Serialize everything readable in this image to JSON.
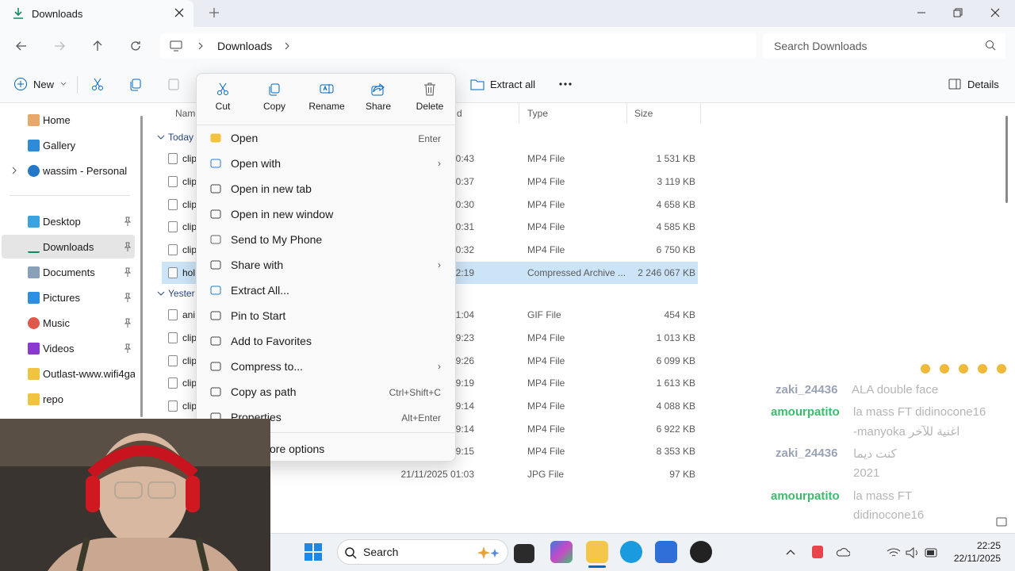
{
  "window": {
    "tab_title": "Downloads"
  },
  "address": {
    "crumb": "Downloads",
    "search_placeholder": "Search Downloads"
  },
  "commands": {
    "new_label": "New",
    "extract_all_label": "Extract all",
    "details_label": "Details"
  },
  "sidebar": {
    "items": [
      {
        "label": "Home"
      },
      {
        "label": "Gallery"
      },
      {
        "label": "wassim - Personal"
      },
      {
        "label": "Desktop"
      },
      {
        "label": "Downloads"
      },
      {
        "label": "Documents"
      },
      {
        "label": "Pictures"
      },
      {
        "label": "Music"
      },
      {
        "label": "Videos"
      },
      {
        "label": "Outlast-www.wifi4gam"
      },
      {
        "label": "repo"
      }
    ]
  },
  "columns": {
    "name": "Nam",
    "date": "d",
    "type": "Type",
    "size": "Size"
  },
  "groups": {
    "today": "Today",
    "yesterday": "Yester"
  },
  "rows": [
    {
      "name": "clip",
      "date": "0:43",
      "type": "MP4 File",
      "size": "1 531 KB"
    },
    {
      "name": "clip",
      "date": "0:37",
      "type": "MP4 File",
      "size": "3 119 KB"
    },
    {
      "name": "clip",
      "date": "0:30",
      "type": "MP4 File",
      "size": "4 658 KB"
    },
    {
      "name": "clip",
      "date": "0:31",
      "type": "MP4 File",
      "size": "4 585 KB"
    },
    {
      "name": "clip",
      "date": "0:32",
      "type": "MP4 File",
      "size": "6 750 KB"
    },
    {
      "name": "hol",
      "date": "2:19",
      "type": "Compressed Archive ...",
      "size": "2 246 067 KB"
    },
    {
      "name": "ani",
      "date": "1:04",
      "type": "GIF File",
      "size": "454 KB"
    },
    {
      "name": "clip",
      "date": "9:23",
      "type": "MP4 File",
      "size": "1 013 KB"
    },
    {
      "name": "clip",
      "date": "9:26",
      "type": "MP4 File",
      "size": "6 099 KB"
    },
    {
      "name": "clip",
      "date": "9:19",
      "type": "MP4 File",
      "size": "1 613 KB"
    },
    {
      "name": "clip",
      "date": "9:14",
      "type": "MP4 File",
      "size": "4 088 KB"
    },
    {
      "name": "",
      "date": "9:14",
      "type": "MP4 File",
      "size": "6 922 KB"
    },
    {
      "name": "",
      "date": "9:15",
      "type": "MP4 File",
      "size": "8 353 KB"
    },
    {
      "name": "",
      "date": "21/11/2025 01:03",
      "type": "JPG File",
      "size": "97 KB"
    }
  ],
  "context_menu": {
    "quick_actions": [
      {
        "label": "Cut",
        "icon": "scissors-icon"
      },
      {
        "label": "Copy",
        "icon": "copy-icon"
      },
      {
        "label": "Rename",
        "icon": "rename-icon"
      },
      {
        "label": "Share",
        "icon": "share-icon"
      },
      {
        "label": "Delete",
        "icon": "trash-icon"
      }
    ],
    "items": [
      {
        "label": "Open",
        "shortcut": "Enter"
      },
      {
        "label": "Open with",
        "shortcut": ""
      },
      {
        "label": "Open in new tab",
        "shortcut": ""
      },
      {
        "label": "Open in new window",
        "shortcut": ""
      },
      {
        "label": "Send to My Phone",
        "shortcut": ""
      },
      {
        "label": "Share with",
        "shortcut": ""
      },
      {
        "label": "Extract All...",
        "shortcut": ""
      },
      {
        "label": "Pin to Start",
        "shortcut": ""
      },
      {
        "label": "Add to Favorites",
        "shortcut": ""
      },
      {
        "label": "Compress to...",
        "shortcut": ""
      },
      {
        "label": "Copy as path",
        "shortcut": "Ctrl+Shift+C"
      },
      {
        "label": "Properties",
        "shortcut": "Alt+Enter"
      }
    ],
    "more_options": "ore options"
  },
  "chat": [
    {
      "user": "zaki_24436",
      "text": "ALA double face",
      "user_color": "#9aa3b5"
    },
    {
      "user": "amourpatito",
      "text": "la mass FT didinocone16",
      "user_color": "#3dbb6d"
    },
    {
      "user": "",
      "text": "-manyoka اغنية للآخر",
      "user_color": ""
    },
    {
      "user": "zaki_24436",
      "text": "كنت ديما",
      "user_color": "#9aa3b5"
    },
    {
      "user": "",
      "text": "2021",
      "user_color": ""
    },
    {
      "user": "amourpatito",
      "text": "la mass FT",
      "user_color": "#3dbb6d"
    },
    {
      "user": "",
      "text": "didinocone16",
      "user_color": ""
    }
  ],
  "taskbar": {
    "search_label": "Search",
    "time": "22:25",
    "date": "22/11/2025"
  },
  "colors": {
    "accent": "#0067c0",
    "selection": "#cce4f7"
  }
}
